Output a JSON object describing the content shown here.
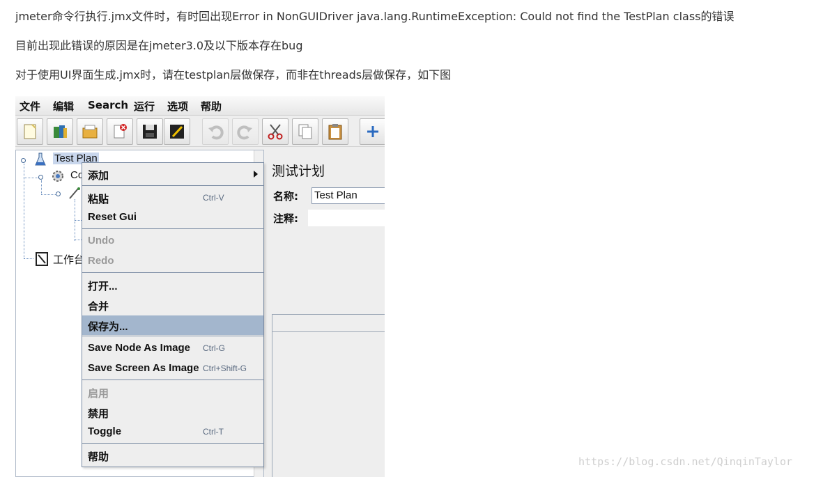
{
  "article": {
    "line1": "jmeter命令行执行.jmx文件时，有时回出现Error in NonGUIDriver java.lang.RuntimeException: Could not find the TestPlan class的错误",
    "line2": "目前出现此错误的原因是在jmeter3.0及以下版本存在bug",
    "line3": "对于使用UI界面生成.jmx时，请在testplan层做保存，而非在threads层做保存，如下图"
  },
  "watermark": "https://blog.csdn.net/QinqinTaylor",
  "menubar": {
    "file": "文件",
    "edit": "编辑",
    "search": "Search",
    "run": "运行",
    "options": "选项",
    "help": "帮助"
  },
  "toolbar": {
    "buttons": [
      "new-icon",
      "templates-icon",
      "open-icon",
      "close-icon",
      "save-icon",
      "edit-icon",
      "undo-icon",
      "redo-icon",
      "cut-icon",
      "copy-icon",
      "paste-icon",
      "expand-icon"
    ]
  },
  "tree": {
    "root": "Test Plan",
    "child_partial": "Co",
    "workbench": "工作台"
  },
  "right_panel": {
    "title": "测试计划",
    "name_label": "名称:",
    "name_value": "Test Plan",
    "comment_label": "注释:"
  },
  "context_menu": {
    "add": "添加",
    "paste": "粘贴",
    "paste_shortcut": "Ctrl-V",
    "reset_gui": "Reset Gui",
    "undo": "Undo",
    "redo": "Redo",
    "open": "打开...",
    "merge": "合并",
    "save_as": "保存为...",
    "save_node_image": "Save Node As Image",
    "save_node_shortcut": "Ctrl-G",
    "save_screen_image": "Save Screen As Image",
    "save_screen_shortcut": "Ctrl+Shift-G",
    "enable": "启用",
    "disable": "禁用",
    "toggle": "Toggle",
    "toggle_shortcut": "Ctrl-T",
    "help": "帮助"
  },
  "colors": {
    "selection": "#c8d6ec",
    "menu_highlight": "#a3b6cd",
    "menu_border": "#7a8ba3"
  }
}
